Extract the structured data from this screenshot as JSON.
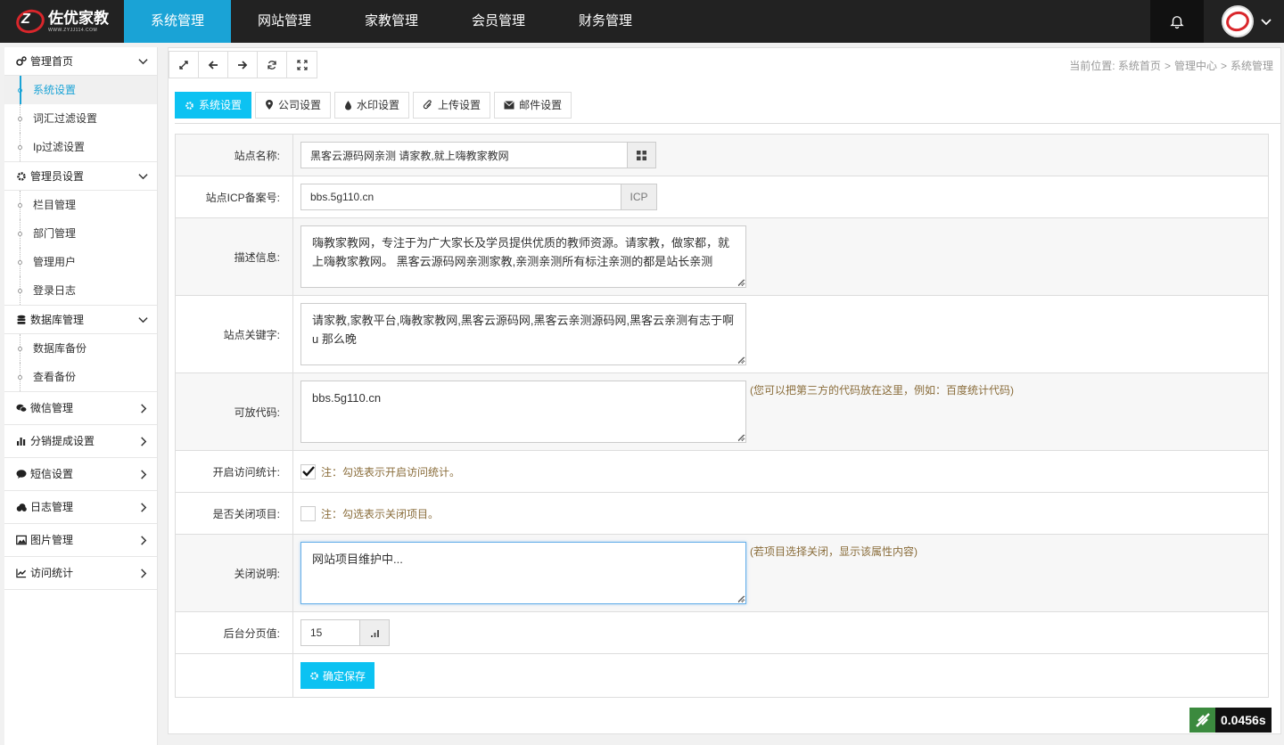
{
  "brand": {
    "name_cn": "佐优家教",
    "name_en": "WWW.ZYJJ114.COM",
    "logo_glyph": "Z"
  },
  "topnav": [
    {
      "label": "系统管理",
      "active": true
    },
    {
      "label": "网站管理",
      "active": false
    },
    {
      "label": "家教管理",
      "active": false
    },
    {
      "label": "会员管理",
      "active": false
    },
    {
      "label": "财务管理",
      "active": false
    }
  ],
  "header_icons": {
    "bell": "bell-icon",
    "avatar_caret": "chevron-down-icon"
  },
  "sidebar": {
    "groups": [
      {
        "label": "管理首页",
        "icon": "cogs-icon",
        "expanded": true,
        "children": [
          "系统设置",
          "词汇过滤设置",
          "Ip过滤设置"
        ]
      },
      {
        "label": "管理员设置",
        "icon": "gear-icon",
        "expanded": true,
        "children": [
          "栏目管理",
          "部门管理",
          "管理用户",
          "登录日志"
        ]
      },
      {
        "label": "数据库管理",
        "icon": "database-icon",
        "expanded": true,
        "children": [
          "数据库备份",
          "查看备份"
        ]
      },
      {
        "label": "微信管理",
        "icon": "wechat-icon",
        "expanded": false
      },
      {
        "label": "分销提成设置",
        "icon": "bar-chart-icon",
        "expanded": false
      },
      {
        "label": "短信设置",
        "icon": "comment-icon",
        "expanded": false
      },
      {
        "label": "日志管理",
        "icon": "cloud-icon",
        "expanded": false
      },
      {
        "label": "图片管理",
        "icon": "picture-icon",
        "expanded": false
      },
      {
        "label": "访问统计",
        "icon": "line-chart-icon",
        "expanded": false
      }
    ]
  },
  "breadcrumb": {
    "prefix": "当前位置:",
    "items": [
      "系统首页",
      "管理中心",
      "系统管理"
    ],
    "separator": ">"
  },
  "toolbar": [
    "expand-icon",
    "arrow-left-icon",
    "arrow-right-icon",
    "refresh-icon",
    "fullscreen-icon"
  ],
  "tabs": [
    {
      "label": "系统设置",
      "icon": "gear-icon",
      "active": true
    },
    {
      "label": "公司设置",
      "icon": "map-marker-icon",
      "active": false
    },
    {
      "label": "水印设置",
      "icon": "tint-icon",
      "active": false
    },
    {
      "label": "上传设置",
      "icon": "paperclip-icon",
      "active": false
    },
    {
      "label": "邮件设置",
      "icon": "envelope-icon",
      "active": false
    }
  ],
  "form": {
    "site_name": {
      "label": "站点名称:",
      "value": "黑客云源码网亲测 请家教,就上嗨教家教网"
    },
    "icp": {
      "label": "站点ICP备案号:",
      "value": "bbs.5g110.cn",
      "addon": "ICP"
    },
    "description": {
      "label": "描述信息:",
      "value": "嗨教家教网，专注于为广大家长及学员提供优质的教师资源。请家教，做家都，就上嗨教家教网。 黑客云源码网亲测家教,亲测亲测所有标注亲测的都是站长亲测"
    },
    "keywords": {
      "label": "站点关键字:",
      "value": "请家教,家教平台,嗨教家教网,黑客云源码网,黑客云亲测源码网,黑客云亲测有志于啊u 那么晚"
    },
    "code": {
      "label": "可放代码:",
      "value": "bbs.5g110.cn",
      "hint": "(您可以把第三方的代码放在这里，例如：百度统计代码)"
    },
    "stats": {
      "label": "开启访问统计:",
      "checked": true,
      "note": "注：勾选表示开启访问统计。"
    },
    "close": {
      "label": "是否关闭项目:",
      "checked": false,
      "note": "注：勾选表示关闭项目。"
    },
    "close_desc": {
      "label": "关闭说明:",
      "value": "网站项目维护中...",
      "hint": "(若项目选择关闭，显示该属性内容)"
    },
    "page_size": {
      "label": "后台分页值:",
      "value": "15"
    },
    "save": {
      "label": "确定保存"
    }
  },
  "timer": {
    "value": "0.0456s"
  },
  "colors": {
    "accent": "#1aa3d6",
    "tab_active": "#0cc2f2",
    "hint": "#8a6d3b",
    "topbar": "#222222"
  }
}
